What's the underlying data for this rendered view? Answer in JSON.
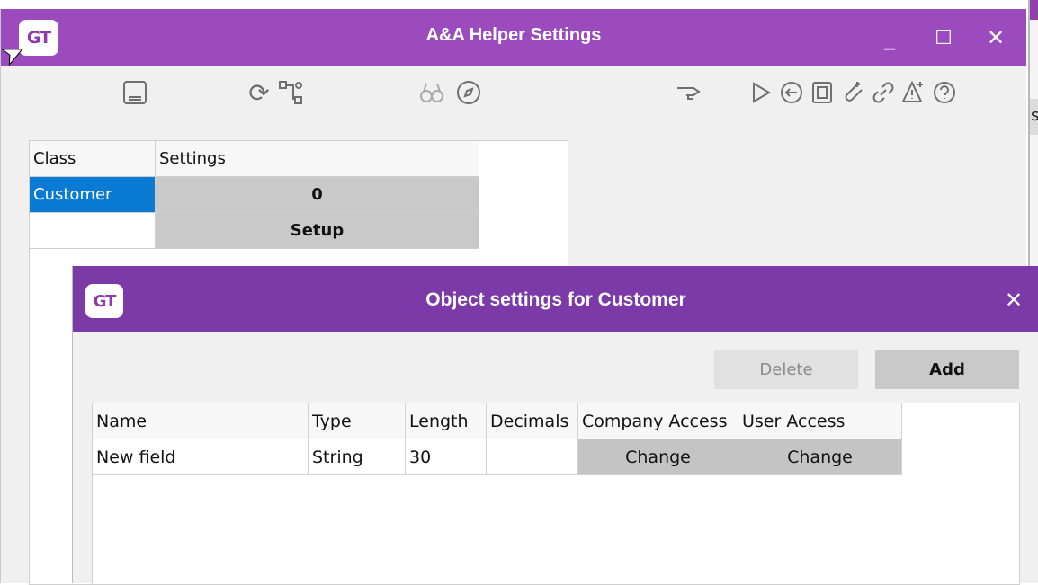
{
  "main_window": {
    "logo": "GT",
    "title": "A&A Helper Settings",
    "controls": {
      "minimize": "_",
      "maximize": "☐",
      "close": "✕"
    }
  },
  "toolbar_icons": [
    "save-icon",
    "refresh-icon",
    "link-tree-icon",
    "binoculars-icon",
    "compass-icon",
    "pointer-hand-icon",
    "play-icon",
    "back-icon",
    "clipboard-icon",
    "attach-icon",
    "chain-link-icon",
    "warning-icon",
    "help-icon"
  ],
  "class_grid": {
    "headers": [
      "Class",
      "Settings"
    ],
    "rows": [
      {
        "class": "Customer",
        "settings": "0"
      },
      {
        "class": "",
        "settings": "Setup"
      }
    ]
  },
  "dialog": {
    "logo": "GT",
    "title": "Object settings for Customer",
    "close": "✕",
    "delete_label": "Delete",
    "add_label": "Add",
    "headers": [
      "Name",
      "Type",
      "Length",
      "Decimals",
      "Company Access",
      "User Access"
    ],
    "rows": [
      {
        "name": "New field",
        "type": "String",
        "length": "30",
        "decimals": "",
        "company_access": "Change",
        "user_access": "Change"
      }
    ]
  },
  "background_window": {
    "truncated_char": "s"
  },
  "colors": {
    "title_purple": "#9b4bbd",
    "dialog_purple": "#7b3aa8",
    "selection_blue": "#0a7ad3",
    "button_grey": "#c9c9c9"
  }
}
